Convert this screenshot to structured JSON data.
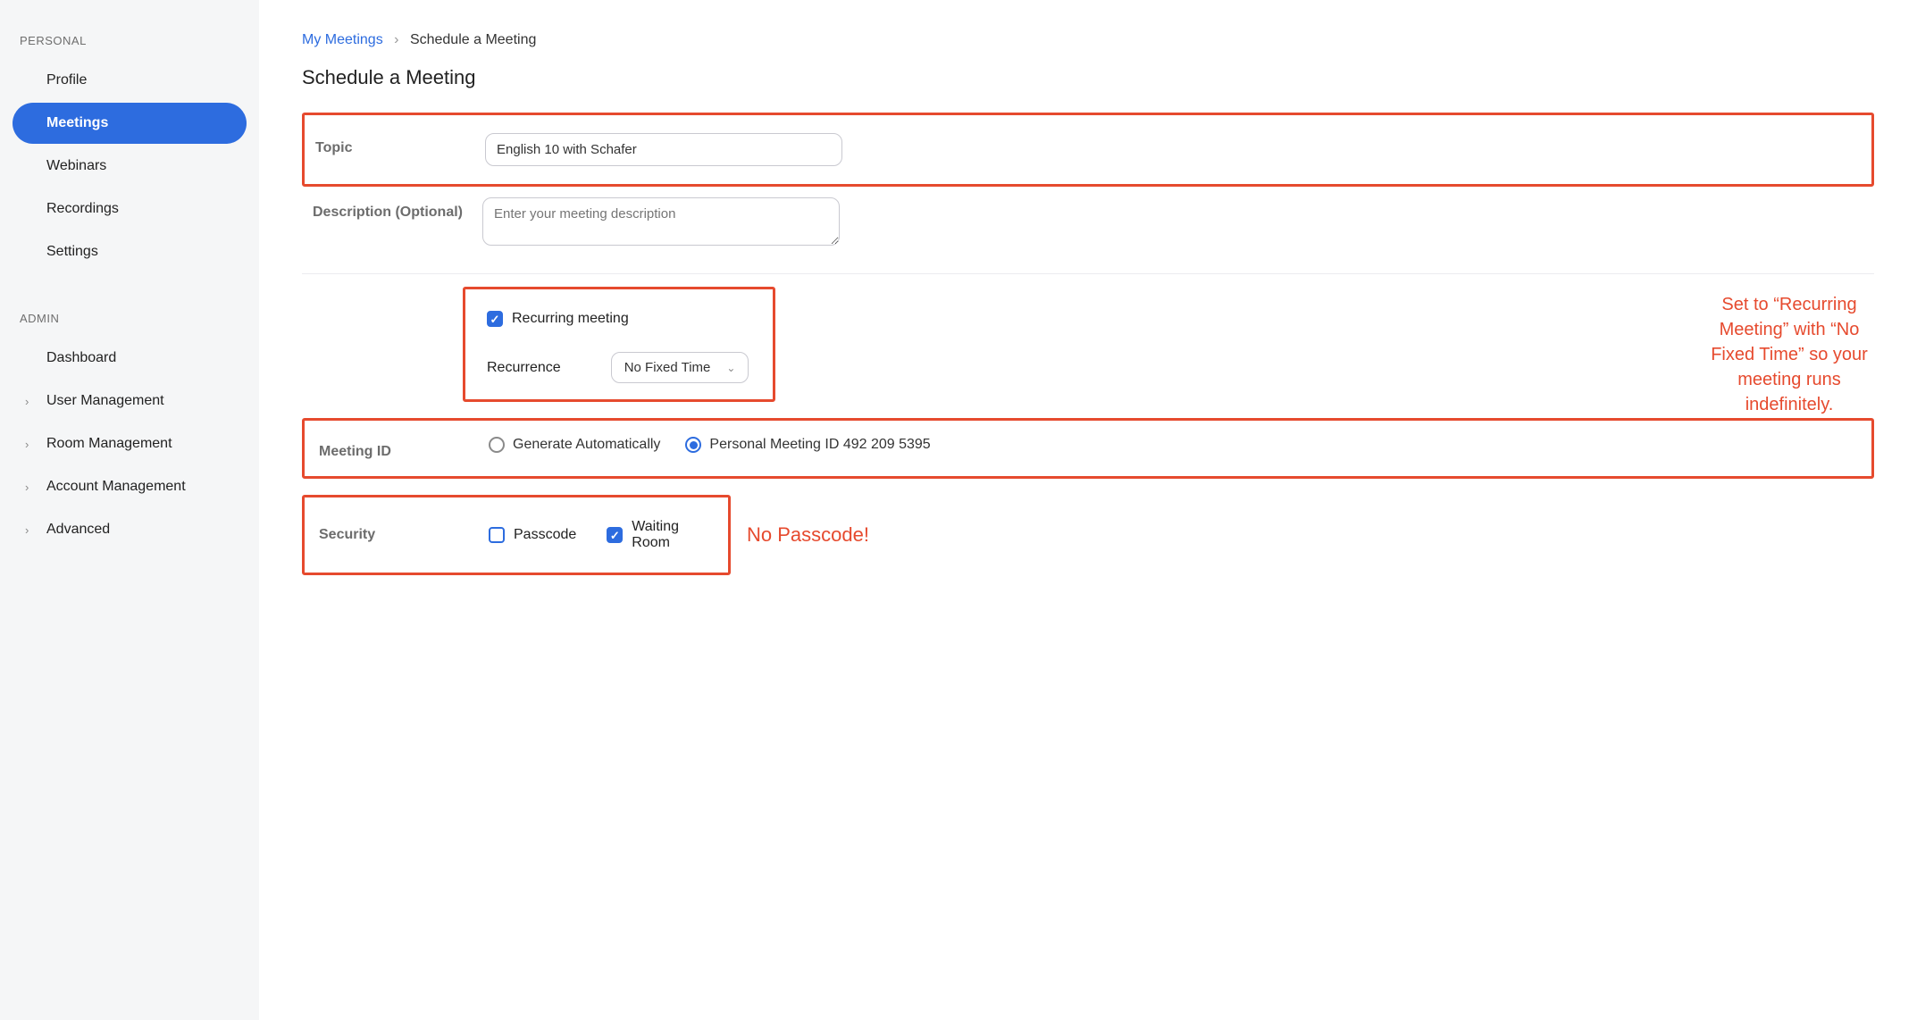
{
  "sidebar": {
    "sections": {
      "personal": {
        "title": "PERSONAL",
        "items": [
          "Profile",
          "Meetings",
          "Webinars",
          "Recordings",
          "Settings"
        ]
      },
      "admin": {
        "title": "ADMIN",
        "items": [
          "Dashboard",
          "User Management",
          "Room Management",
          "Account Management",
          "Advanced"
        ]
      }
    },
    "active": "Meetings"
  },
  "breadcrumb": {
    "parent": "My Meetings",
    "current": "Schedule a Meeting"
  },
  "page_title": "Schedule a Meeting",
  "form": {
    "topic": {
      "label": "Topic",
      "value": "English 10 with Schafer"
    },
    "description": {
      "label": "Description (Optional)",
      "placeholder": "Enter your meeting description"
    },
    "recurring": {
      "checkbox_label": "Recurring meeting",
      "checked": true,
      "recurrence_label": "Recurrence",
      "recurrence_value": "No Fixed Time"
    },
    "meeting_id": {
      "label": "Meeting ID",
      "options": {
        "auto": "Generate Automatically",
        "personal": "Personal Meeting ID 492 209 5395"
      },
      "selected": "personal"
    },
    "security": {
      "label": "Security",
      "passcode": {
        "label": "Passcode",
        "checked": false
      },
      "waiting_room": {
        "label": "Waiting Room",
        "checked": true
      }
    }
  },
  "annotations": {
    "recurring": "Set to “Recurring Meeting” with “No Fixed Time” so your meeting runs indefinitely.",
    "passcode": "No Passcode!"
  }
}
